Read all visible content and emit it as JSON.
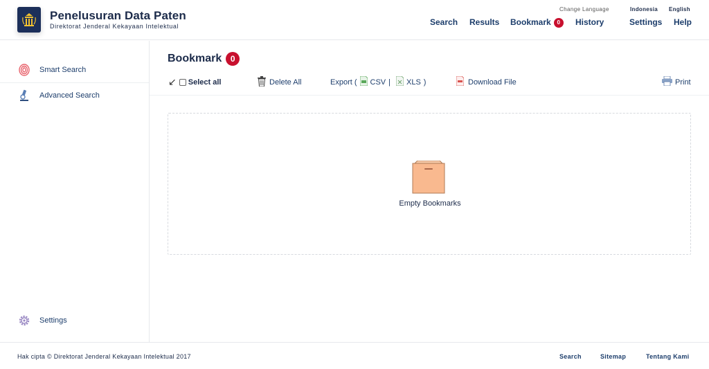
{
  "header": {
    "title": "Penelusuran Data Paten",
    "subtitle": "Direktorat Jenderal Kekayaan Intelektual",
    "nav": {
      "search": "Search",
      "results": "Results",
      "bookmark": "Bookmark",
      "bookmark_count": "0",
      "history": "History",
      "settings": "Settings",
      "help": "Help"
    },
    "language": {
      "label": "Change Language",
      "option_id": "Indonesia",
      "option_en": "English"
    }
  },
  "sidebar": {
    "items": [
      {
        "label": "Smart Search",
        "icon": "fingerprint-icon"
      },
      {
        "label": "Advanced Search",
        "icon": "microscope-icon"
      },
      {
        "label": "Settings",
        "icon": "gear-icon"
      }
    ]
  },
  "main": {
    "title": "Bookmark",
    "count": "0",
    "toolbar": {
      "select_all": "Select all",
      "delete_all": "Delete All",
      "export_open": "Export (",
      "csv": "CSV",
      "separator": "|",
      "xls": "XLS",
      "export_close": ")",
      "download": "Download File",
      "print": "Print"
    },
    "empty_text": "Empty Bookmarks"
  },
  "footer": {
    "copyright": "Hak cipta © Direktorat Jenderal Kekayaan Intelektual 2017",
    "links": {
      "search": "Search",
      "sitemap": "Sitemap",
      "about": "Tentang Kami"
    }
  },
  "colors": {
    "accent": "#c8102e",
    "navy": "#1c3d6b",
    "logo_bg": "#1c2f5a"
  }
}
